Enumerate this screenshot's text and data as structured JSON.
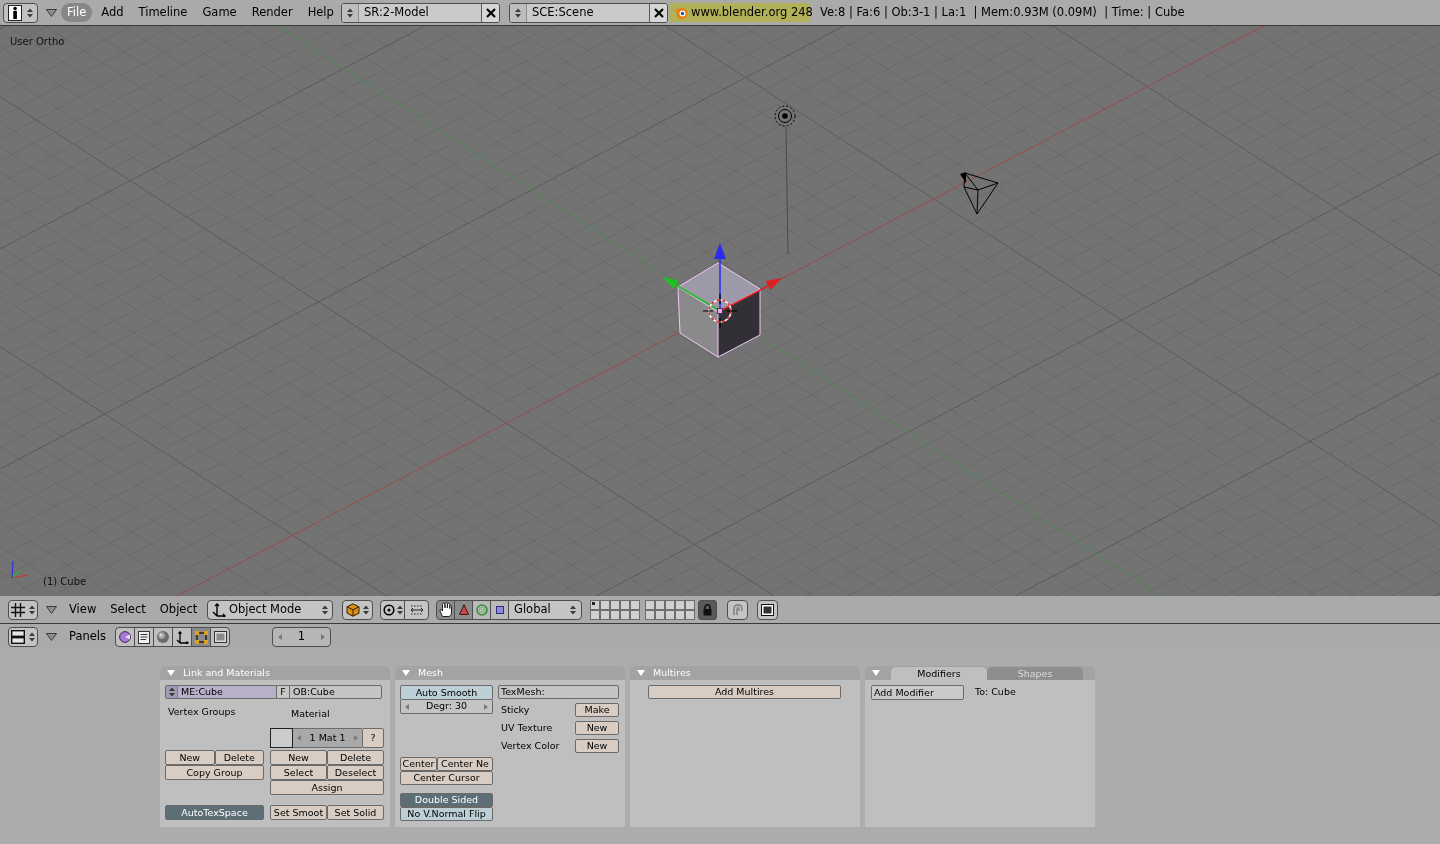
{
  "top_header": {
    "menus": [
      {
        "label": "File",
        "selected": true
      },
      {
        "label": "Add",
        "selected": false
      },
      {
        "label": "Timeline",
        "selected": false
      },
      {
        "label": "Game",
        "selected": false
      },
      {
        "label": "Render",
        "selected": false
      },
      {
        "label": "Help",
        "selected": false
      }
    ],
    "screen_selector": "SR:2-Model",
    "scene_selector": "SCE:Scene",
    "version": "www.blender.org 248",
    "stats": "Ve:8 | Fa:6 | Ob:3-1 | La:1  | Mem:0.93M (0.09M)  | Time: | Cube"
  },
  "viewport": {
    "view_name": "User Ortho",
    "active_object": "(1) Cube"
  },
  "view3d_header": {
    "menus": [
      "View",
      "Select",
      "Object"
    ],
    "mode": "Object Mode",
    "manipulators": [
      {
        "kind": "hand",
        "on": true
      },
      {
        "kind": "translate",
        "on": true
      },
      {
        "kind": "rotate",
        "on": false
      },
      {
        "kind": "scale",
        "on": false
      }
    ],
    "orientation": "Global",
    "layers": [
      {
        "has_objects": true
      },
      {
        "has_objects": false
      },
      {
        "has_objects": false
      },
      {
        "has_objects": false
      },
      {
        "has_objects": false
      },
      {
        "has_objects": false
      },
      {
        "has_objects": false
      },
      {
        "has_objects": false
      },
      {
        "has_objects": false
      },
      {
        "has_objects": false
      },
      {
        "has_objects": false
      },
      {
        "has_objects": false
      },
      {
        "has_objects": false
      },
      {
        "has_objects": false
      },
      {
        "has_objects": false
      },
      {
        "has_objects": false
      },
      {
        "has_objects": false
      },
      {
        "has_objects": false
      },
      {
        "has_objects": false
      },
      {
        "has_objects": false
      }
    ]
  },
  "buttons_header": {
    "label": "Panels",
    "contexts": [
      {
        "kind": "logic",
        "selected": false
      },
      {
        "kind": "script",
        "selected": false
      },
      {
        "kind": "shading",
        "selected": false
      },
      {
        "kind": "object",
        "selected": false
      },
      {
        "kind": "editing",
        "selected": true
      },
      {
        "kind": "scene",
        "selected": false
      }
    ],
    "frame": "1"
  },
  "panels": [
    {
      "kind": "link_materials",
      "title": "Link and Materials",
      "expanded": true,
      "mesh_name": "ME:Cube",
      "fake_user": "F",
      "object_name": "OB:Cube",
      "vertex_groups_label": "Vertex Groups",
      "vertex_group_buttons": [
        "New",
        "Delete"
      ],
      "copy_group": "Copy Group",
      "auto_tex_space": {
        "label": "AutoTexSpace",
        "on": true
      },
      "material_label": "Material",
      "material_index": "1 Mat 1",
      "material_help": "?",
      "material_buttons": [
        "New",
        "Delete",
        "Select",
        "Deselect"
      ],
      "assign": "Assign",
      "smooth_buttons": [
        "Set Smoot",
        "Set Solid"
      ]
    },
    {
      "kind": "mesh",
      "title": "Mesh",
      "expanded": true,
      "auto_smooth": {
        "label": "Auto Smooth",
        "on": false
      },
      "degree": "Degr: 30",
      "center_buttons": [
        "Center",
        "Center Ne"
      ],
      "center_cursor": "Center Cursor",
      "double_sided": {
        "label": "Double Sided",
        "on": true
      },
      "normal_flip": {
        "label": "No V.Normal Flip",
        "on": false
      },
      "tex_mesh": "TexMesh:",
      "data_layers": [
        {
          "label": "Sticky",
          "button": "Make"
        },
        {
          "label": "UV Texture",
          "button": "New"
        },
        {
          "label": "Vertex Color",
          "button": "New"
        }
      ]
    },
    {
      "kind": "multires",
      "title": "Multires",
      "expanded": true,
      "button": "Add Multires"
    },
    {
      "kind": "modifiers",
      "expanded": true,
      "tabs": [
        {
          "label": "Modifiers",
          "selected": true
        },
        {
          "label": "Shapes",
          "selected": false
        }
      ],
      "button": "Add Modifier",
      "target": "To: Cube"
    }
  ]
}
